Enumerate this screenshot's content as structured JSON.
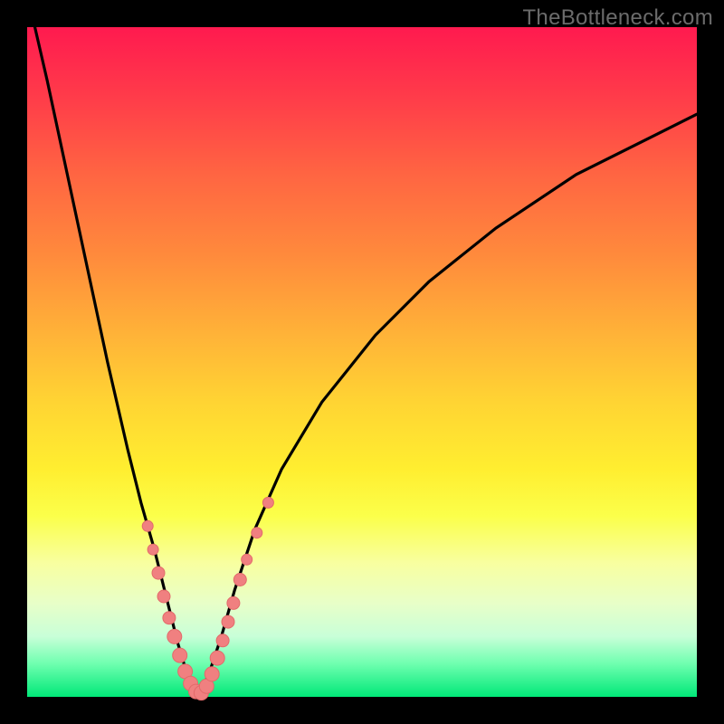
{
  "watermark": "TheBottleneck.com",
  "colors": {
    "frame": "#000000",
    "curve": "#000000",
    "marker_fill": "#f08080",
    "marker_stroke": "#e26a6a",
    "gradient_top": "#ff1a4f",
    "gradient_bottom": "#00e878"
  },
  "chart_data": {
    "type": "line",
    "title": "",
    "xlabel": "",
    "ylabel": "",
    "xlim": [
      0,
      100
    ],
    "ylim": [
      0,
      100
    ],
    "series": [
      {
        "name": "bottleneck-curve",
        "x": [
          0,
          3,
          6,
          9,
          12,
          15,
          17,
          19,
          21,
          22.5,
          24,
          25.5,
          27,
          29,
          31,
          34,
          38,
          44,
          52,
          60,
          70,
          82,
          94,
          100
        ],
        "y": [
          105,
          92,
          78,
          64,
          50,
          37,
          29,
          22,
          14,
          8,
          3,
          0.5,
          3,
          9,
          16,
          25,
          34,
          44,
          54,
          62,
          70,
          78,
          84,
          87
        ]
      }
    ],
    "markers": [
      {
        "x": 18.0,
        "y": 25.5,
        "r": 6
      },
      {
        "x": 18.8,
        "y": 22.0,
        "r": 6
      },
      {
        "x": 19.6,
        "y": 18.5,
        "r": 7
      },
      {
        "x": 20.4,
        "y": 15.0,
        "r": 7
      },
      {
        "x": 21.2,
        "y": 11.8,
        "r": 7
      },
      {
        "x": 22.0,
        "y": 9.0,
        "r": 8
      },
      {
        "x": 22.8,
        "y": 6.2,
        "r": 8
      },
      {
        "x": 23.6,
        "y": 3.8,
        "r": 8
      },
      {
        "x": 24.4,
        "y": 2.0,
        "r": 8
      },
      {
        "x": 25.2,
        "y": 0.8,
        "r": 8
      },
      {
        "x": 26.0,
        "y": 0.6,
        "r": 8
      },
      {
        "x": 26.8,
        "y": 1.6,
        "r": 8
      },
      {
        "x": 27.6,
        "y": 3.4,
        "r": 8
      },
      {
        "x": 28.4,
        "y": 5.8,
        "r": 8
      },
      {
        "x": 29.2,
        "y": 8.4,
        "r": 7
      },
      {
        "x": 30.0,
        "y": 11.2,
        "r": 7
      },
      {
        "x": 30.8,
        "y": 14.0,
        "r": 7
      },
      {
        "x": 31.8,
        "y": 17.5,
        "r": 7
      },
      {
        "x": 32.8,
        "y": 20.5,
        "r": 6
      },
      {
        "x": 34.3,
        "y": 24.5,
        "r": 6
      },
      {
        "x": 36.0,
        "y": 29.0,
        "r": 6
      }
    ]
  }
}
